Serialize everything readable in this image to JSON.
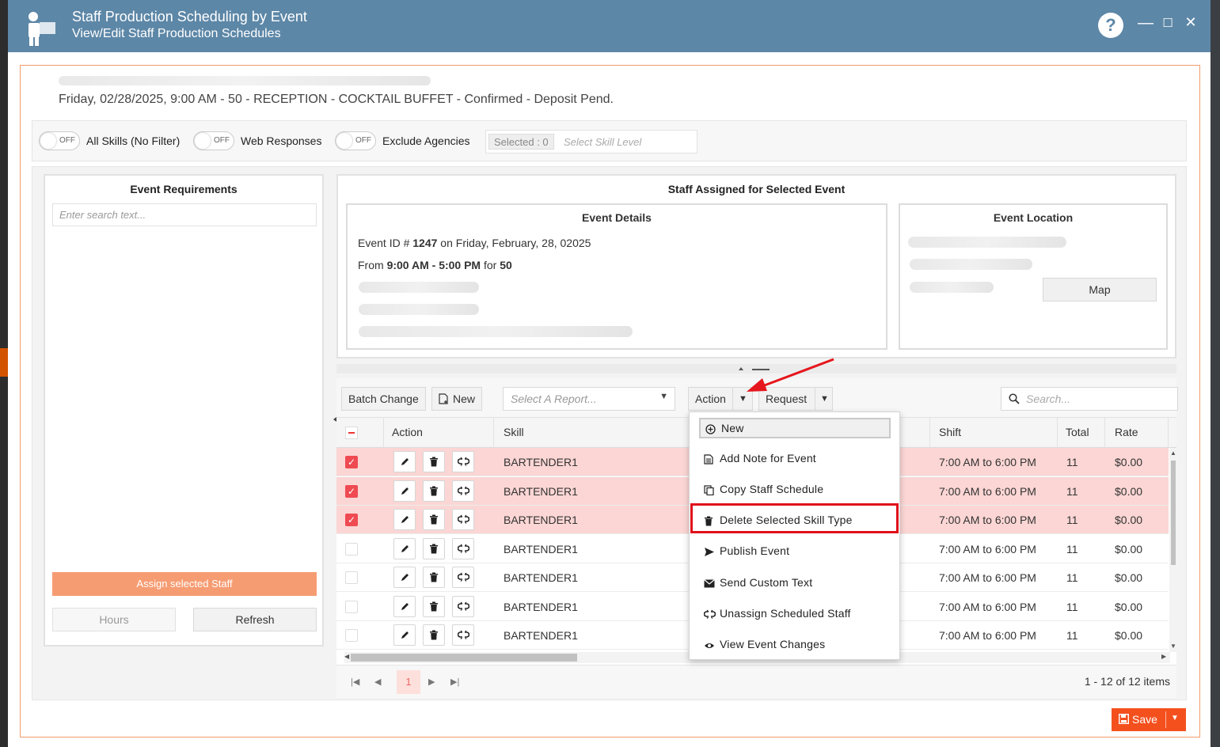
{
  "window": {
    "title": "Staff Production Scheduling by Event",
    "subtitle": "View/Edit Staff Production Schedules",
    "help": "?",
    "minimize": "—",
    "maximize": "☐",
    "close": "✕"
  },
  "event_header": "Friday, 02/28/2025, 9:00 AM - 50 - RECEPTION - COCKTAIL BUFFET - Confirmed - Deposit Pend.",
  "filters": {
    "toggle_state": "OFF",
    "all_skills": "All Skills (No Filter)",
    "web_responses": "Web Responses",
    "exclude_agencies": "Exclude Agencies",
    "selected_count": "Selected : 0",
    "skill_level_placeholder": "Select Skill Level"
  },
  "left_panel": {
    "title": "Event Requirements",
    "search_placeholder": "Enter search text...",
    "assign_button": "Assign selected Staff",
    "hours_button": "Hours",
    "refresh_button": "Refresh"
  },
  "assigned_panel": {
    "title": "Staff Assigned for Selected Event",
    "details": {
      "title": "Event Details",
      "id_prefix": "Event ID # ",
      "id": "1247",
      "date_text": " on Friday, February, 28, 02025",
      "from_prefix": "From ",
      "start": "9:00 AM",
      "dash": " - ",
      "end": "5:00 PM",
      "for_text": " for ",
      "count": "50"
    },
    "location": {
      "title": "Event Location",
      "map_button": "Map"
    }
  },
  "toolbar": {
    "batch_change": "Batch Change",
    "new": "New",
    "report_placeholder": "Select A Report...",
    "action": "Action",
    "request": "Request",
    "search_placeholder": "Search..."
  },
  "grid": {
    "columns": [
      "Action",
      "Skill",
      "Shift",
      "Total",
      "Rate"
    ],
    "rows": [
      {
        "selected": true,
        "skill": "BARTENDER1",
        "shift": "7:00 AM to 6:00 PM",
        "total": "11",
        "rate": "$0.00"
      },
      {
        "selected": true,
        "skill": "BARTENDER1",
        "shift": "7:00 AM to 6:00 PM",
        "total": "11",
        "rate": "$0.00"
      },
      {
        "selected": true,
        "skill": "BARTENDER1",
        "shift": "7:00 AM to 6:00 PM",
        "total": "11",
        "rate": "$0.00"
      },
      {
        "selected": false,
        "skill": "BARTENDER1",
        "shift": "7:00 AM to 6:00 PM",
        "total": "11",
        "rate": "$0.00"
      },
      {
        "selected": false,
        "skill": "BARTENDER1",
        "shift": "7:00 AM to 6:00 PM",
        "total": "11",
        "rate": "$0.00"
      },
      {
        "selected": false,
        "skill": "BARTENDER1",
        "shift": "7:00 AM to 6:00 PM",
        "total": "11",
        "rate": "$0.00"
      },
      {
        "selected": false,
        "skill": "BARTENDER1",
        "shift": "7:00 AM to 6:00 PM",
        "total": "11",
        "rate": "$0.00"
      }
    ]
  },
  "pager": {
    "current_page": "1",
    "info": "1 - 12 of 12 items"
  },
  "action_menu": {
    "items": [
      {
        "label": "New",
        "icon": "plus-circle-icon"
      },
      {
        "label": "Add Note for Event",
        "icon": "note-icon"
      },
      {
        "label": "Copy Staff Schedule",
        "icon": "copy-icon"
      },
      {
        "label": "Delete Selected Skill Type",
        "icon": "trash-icon"
      },
      {
        "label": "Publish Event",
        "icon": "send-icon"
      },
      {
        "label": "Send Custom Text",
        "icon": "envelope-icon"
      },
      {
        "label": "Unassign Scheduled Staff",
        "icon": "unlink-icon"
      },
      {
        "label": "View Event Changes",
        "icon": "eye-icon"
      }
    ],
    "highlighted": "Delete Selected Skill Type"
  },
  "save_button": "Save",
  "colors": {
    "titlebar": "#5d87a7",
    "accent_orange": "#f4501e",
    "selected_row": "#fbd6d4",
    "highlight_red": "#e0101a"
  }
}
